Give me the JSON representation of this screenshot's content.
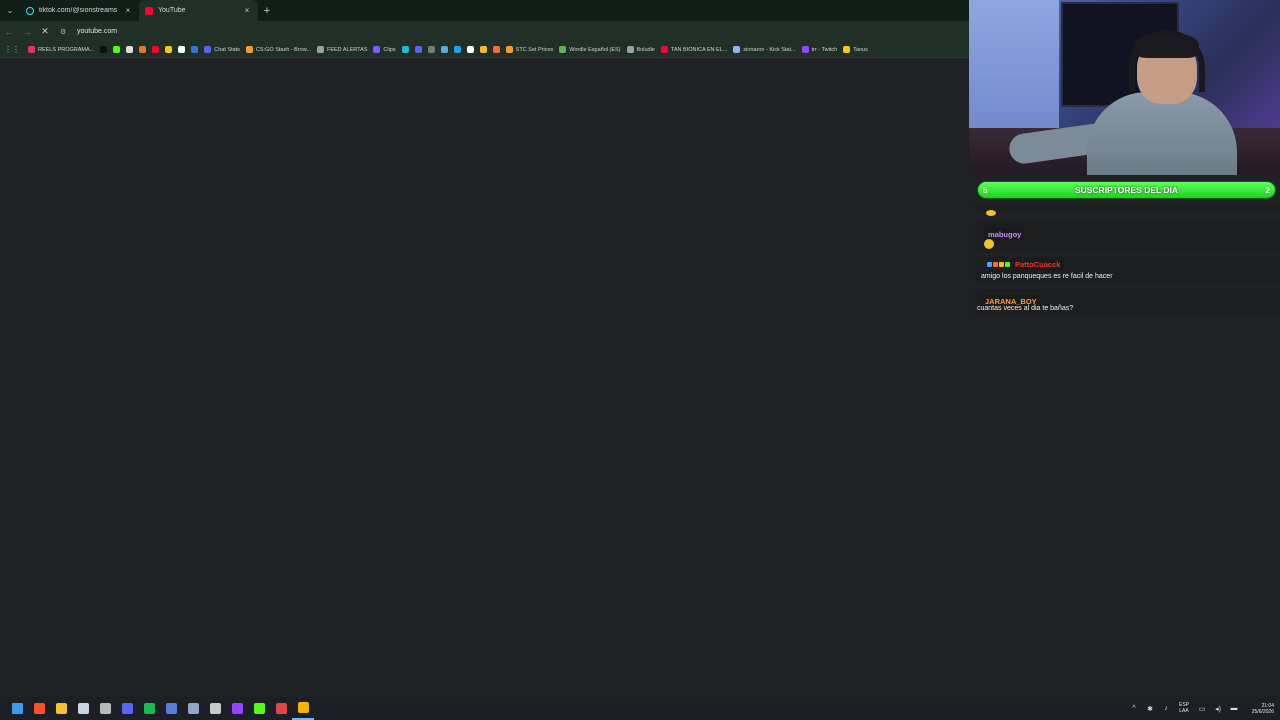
{
  "browser": {
    "tab_list_glyph": "⌄",
    "tabs": [
      {
        "title": "tiktok.com/@sionstreams",
        "favicon": "tiktok-icon",
        "active": false
      },
      {
        "title": "YouTube",
        "favicon": "youtube-icon",
        "active": true
      }
    ],
    "close_glyph": "×",
    "new_tab_glyph": "+",
    "nav": {
      "back": "←",
      "forward": "→",
      "stop": "✕"
    },
    "url": "youtube.com",
    "bookmarks": [
      {
        "label": "REELS PROGRAMA...",
        "color": "#e1306c"
      },
      {
        "label": "",
        "color": "#111111"
      },
      {
        "label": "",
        "color": "#53fc18"
      },
      {
        "label": "",
        "color": "#dddddd"
      },
      {
        "label": "",
        "color": "#e07a2e"
      },
      {
        "label": "",
        "color": "#ff0033"
      },
      {
        "label": "",
        "color": "#f5c518"
      },
      {
        "label": "",
        "color": "#ffffff"
      },
      {
        "label": "",
        "color": "#3a6fd8"
      },
      {
        "label": "Chat Stats",
        "color": "#5865f2"
      },
      {
        "label": "CS:GO Stash - Brow...",
        "color": "#f0a030"
      },
      {
        "label": "FEED ALERTAS",
        "color": "#9aa0a6"
      },
      {
        "label": "Clips",
        "color": "#7b5cff"
      },
      {
        "label": "",
        "color": "#22b8cf"
      },
      {
        "label": "",
        "color": "#5865f2"
      },
      {
        "label": "",
        "color": "#7a7a7a"
      },
      {
        "label": "",
        "color": "#5aa9e6"
      },
      {
        "label": "",
        "color": "#1da1f2"
      },
      {
        "label": "",
        "color": "#ffffff"
      },
      {
        "label": "",
        "color": "#f3ba2f"
      },
      {
        "label": "",
        "color": "#ff6b35"
      },
      {
        "label": "STC Set Prices",
        "color": "#f0a030"
      },
      {
        "label": "Wordle Español (ES)",
        "color": "#6aaa64"
      },
      {
        "label": "Boludle",
        "color": "#9aa0a6"
      },
      {
        "label": "TAN BIONICA EN EL...",
        "color": "#ff0033"
      },
      {
        "label": "sionaron - Kick Stat...",
        "color": "#8ab4f8"
      },
      {
        "label": "trr - Twitch",
        "color": "#9146ff"
      },
      {
        "label": "Tanus",
        "color": "#f5c518"
      }
    ]
  },
  "overlay": {
    "subs_bar": {
      "left_count": "5",
      "label": "SUSCRIPTORES DEL DIA",
      "right_count": "2"
    },
    "chat": [
      {
        "user": "",
        "text": "",
        "emote": true,
        "user_color": "#f2c12b"
      },
      {
        "user": "mabugoy",
        "text": "",
        "emote": true,
        "user_color": "#c98bff"
      },
      {
        "user": "PattoCuacck",
        "text": "amigo los panqueques es re facil de hacer",
        "emote": false,
        "user_color": "#ff2a2a"
      },
      {
        "user": "JARANA_BOY",
        "text": "cuantas veces al dia te bañas?",
        "emote": false,
        "user_color": "#ff9d2a"
      }
    ]
  },
  "taskbar": {
    "icons": [
      {
        "name": "windows-start-icon",
        "color": "#3d9ae8"
      },
      {
        "name": "brave-icon",
        "color": "#fb542b"
      },
      {
        "name": "file-explorer-icon",
        "color": "#f2c230"
      },
      {
        "name": "steam-icon",
        "color": "#c7d5e0"
      },
      {
        "name": "obs-icon",
        "color": "#b8b8b8"
      },
      {
        "name": "discord-icon",
        "color": "#5865f2"
      },
      {
        "name": "spotify-icon",
        "color": "#1db954"
      },
      {
        "name": "screen-icon",
        "color": "#5a7bd8"
      },
      {
        "name": "controller-icon",
        "color": "#8fa8c8"
      },
      {
        "name": "settings-icon",
        "color": "#c8c8c8"
      },
      {
        "name": "twitch-icon",
        "color": "#9146ff"
      },
      {
        "name": "kick-icon",
        "color": "#53fc18"
      },
      {
        "name": "streamlabs-icon",
        "color": "#e04848"
      },
      {
        "name": "chrome-icon",
        "color": "#f4b400"
      }
    ],
    "tray": {
      "chevron": "^",
      "lang_line1": "ESP",
      "lang_line2": "LAA",
      "time": "21:04",
      "date": "25/6/2026"
    }
  }
}
